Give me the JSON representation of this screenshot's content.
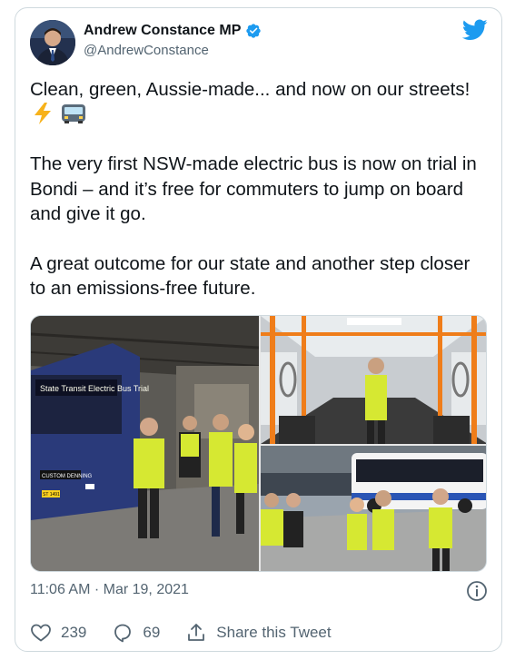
{
  "author": {
    "name": "Andrew Constance MP",
    "handle": "@AndrewConstance",
    "verified_icon": "verified-badge-icon",
    "avatar": "profile-photo"
  },
  "brand_icon": "twitter-bird-icon",
  "tweet": {
    "line1": "Clean, green, Aussie-made... and now on our streets!",
    "line1_emojis": [
      "high-voltage-emoji",
      "bus-emoji"
    ],
    "paragraph2": "The very first NSW-made electric bus is now on trial in Bondi – and it’s free for commuters to jump on board and give it go.",
    "paragraph3": "A great outcome for our state and another step closer to an emissions-free future."
  },
  "media": {
    "photos": [
      {
        "label": "photo-electric-bus-depot"
      },
      {
        "label": "photo-bus-interior"
      },
      {
        "label": "photo-bus-yard-group"
      }
    ],
    "bus_signage": "State Transit Electric Bus Trial",
    "bus_brand": "CUSTOM DENNING",
    "bus_plate": "ST 1491"
  },
  "timestamp": "11:06 AM · Mar 19, 2021",
  "actions": {
    "like_count": "239",
    "reply_count": "69",
    "share_label": "Share this Tweet"
  },
  "colors": {
    "twitter_blue": "#1d9bf0",
    "text_primary": "#0f1419",
    "text_secondary": "#536471",
    "border": "#cfd9de"
  }
}
